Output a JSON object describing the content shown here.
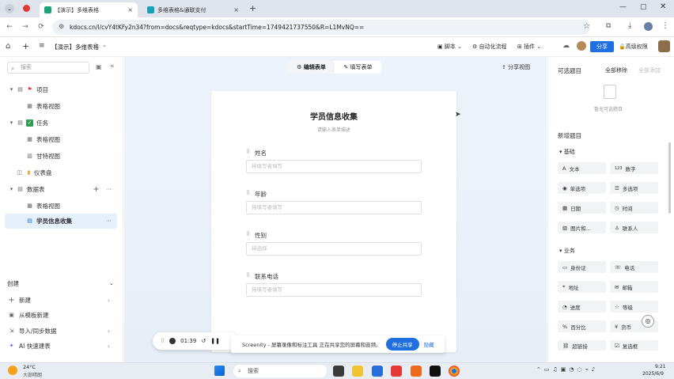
{
  "browser": {
    "tabs": [
      {
        "label": "【演示】多维表格",
        "active": true
      },
      {
        "label": "多维表格&通联支付",
        "active": false
      }
    ],
    "url": "kdocs.cn/l/cvY4tKFy2n34?from=docs&reqtype=kdocs&startTime=1749421737550&R=L1MvNQ=="
  },
  "app": {
    "doc_title": "【演示】多维表格",
    "toolbar": [
      "脚本",
      "自动化流程",
      "插件"
    ],
    "share_label": "分享",
    "advanced_label": "高级权限"
  },
  "sidebar": {
    "search_placeholder": "搜索",
    "items": [
      {
        "label": "项目",
        "icon": "flag-icon"
      },
      {
        "label": "表格视图"
      },
      {
        "label": "任务",
        "icon": "check-icon"
      },
      {
        "label": "表格视图"
      },
      {
        "label": "甘特视图"
      },
      {
        "label": "仪表盘"
      },
      {
        "label": "数据表"
      },
      {
        "label": "表格视图"
      },
      {
        "label": "学员信息收集"
      }
    ],
    "create_title": "创建",
    "create_items": [
      "新建",
      "从模板新建",
      "导入/同步数据",
      "AI 快速建表"
    ]
  },
  "canvas": {
    "tabs": [
      "编辑表单",
      "填写表单"
    ],
    "share_view": "分享视图",
    "form_title": "学员信息收集",
    "form_desc": "请输入表单描述",
    "fields": [
      {
        "label": "姓名",
        "placeholder": "待填写者填写"
      },
      {
        "label": "年龄",
        "placeholder": "待填写者填写"
      },
      {
        "label": "性别",
        "placeholder": "待选择"
      },
      {
        "label": "联系电话",
        "placeholder": "待填写者填写"
      }
    ]
  },
  "right_panel": {
    "title": "可选题目",
    "remove_all": "全部移除",
    "select_all": "全部添加",
    "empty": "暂无可选题目",
    "new_title": "新增题目",
    "basic": "基础",
    "basic_chips": [
      "文本",
      "数字",
      "单选项",
      "多选项",
      "日期",
      "时间",
      "图片和...",
      "联系人"
    ],
    "biz": "业务",
    "biz_chips": [
      "身份证",
      "电话",
      "地址",
      "邮箱",
      "进度",
      "等级",
      "百分比",
      "货币",
      "超链接",
      "复选框"
    ]
  },
  "recorder": {
    "time": "01:39"
  },
  "sharebar": {
    "text": "Screenity - 屏幕录像和标注工具 正在共享您的屏幕和音频。",
    "stop": "停止共享",
    "hide": "隐藏"
  },
  "taskbar": {
    "weather_temp": "24°C",
    "weather_desc": "大部晴朗",
    "search": "搜索",
    "time": "9:21",
    "date": "2025/6/9"
  }
}
